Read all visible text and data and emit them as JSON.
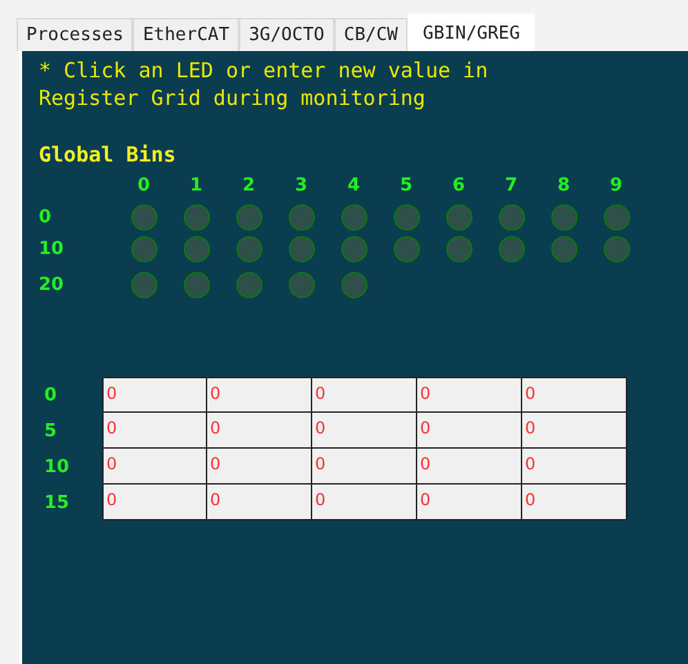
{
  "tabs": [
    {
      "label": "Processes",
      "selected": false
    },
    {
      "label": "EtherCAT",
      "selected": false
    },
    {
      "label": "3G/OCTO",
      "selected": false
    },
    {
      "label": "CB/CW",
      "selected": false
    },
    {
      "label": "GBIN/GREG",
      "selected": true
    }
  ],
  "instructions": "* Click an LED or enter new value in Register Grid during monitoring",
  "global_bins": {
    "title": "Global Bins",
    "column_headers": [
      "0",
      "1",
      "2",
      "3",
      "4",
      "5",
      "6",
      "7",
      "8",
      "9"
    ],
    "rows": [
      {
        "label": "0",
        "leds": [
          {
            "on": false
          },
          {
            "on": false
          },
          {
            "on": false
          },
          {
            "on": false
          },
          {
            "on": false
          },
          {
            "on": false
          },
          {
            "on": false
          },
          {
            "on": false
          },
          {
            "on": false
          },
          {
            "on": false
          }
        ]
      },
      {
        "label": "10",
        "leds": [
          {
            "on": false
          },
          {
            "on": false
          },
          {
            "on": false
          },
          {
            "on": false
          },
          {
            "on": false
          },
          {
            "on": false
          },
          {
            "on": false
          },
          {
            "on": false
          },
          {
            "on": false
          },
          {
            "on": false
          }
        ]
      },
      {
        "label": "20",
        "leds": [
          {
            "on": false
          },
          {
            "on": false
          },
          {
            "on": false
          },
          {
            "on": false
          },
          {
            "on": false
          }
        ]
      }
    ]
  },
  "register_grid": {
    "rows": [
      {
        "label": "0",
        "cells": [
          "0",
          "0",
          "0",
          "0",
          "0"
        ]
      },
      {
        "label": "5",
        "cells": [
          "0",
          "0",
          "0",
          "0",
          "0"
        ]
      },
      {
        "label": "10",
        "cells": [
          "0",
          "0",
          "0",
          "0",
          "0"
        ]
      },
      {
        "label": "15",
        "cells": [
          "0",
          "0",
          "0",
          "0",
          "0"
        ]
      }
    ]
  }
}
